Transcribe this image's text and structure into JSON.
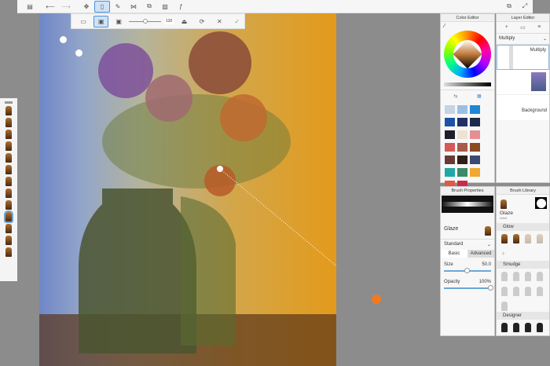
{
  "toolbar": {
    "items": [
      {
        "icon": "gallery-icon"
      },
      {
        "icon": "undo-icon"
      },
      {
        "icon": "redo-icon"
      },
      {
        "icon": "transform-icon"
      },
      {
        "icon": "brush-icon",
        "active": true
      },
      {
        "icon": "pencil-icon"
      },
      {
        "icon": "symmetry-icon"
      },
      {
        "icon": "layers-icon"
      },
      {
        "icon": "image-icon"
      },
      {
        "icon": "curve-icon"
      }
    ]
  },
  "subtoolbar": {
    "size_value": "120"
  },
  "color_editor": {
    "title": "Color Editor",
    "swatches": [
      "#c4d3e6",
      "#9bbfe3",
      "#1f86d6",
      "#1c53a8",
      "#222f66",
      "#1f2a4a",
      "#1e1e2c",
      "#eee2d0",
      "#e49092",
      "#d45b58",
      "#a95a4a",
      "#8a4a22",
      "#6a3a38",
      "#2e1e16",
      "#3a4a70",
      "#20a8a6",
      "#3d8a68",
      "#f0a830",
      "#e05a44",
      "#cc2a4c"
    ]
  },
  "layer_editor": {
    "title": "Layer Editor",
    "blend_mode": "Multiply",
    "layers": [
      {
        "name": "Multiply"
      },
      {
        "name": ""
      },
      {
        "name": "Background"
      }
    ]
  },
  "brush_properties": {
    "title": "Brush Properties",
    "brush_name": "Glaze",
    "mode": "Standard",
    "tabs": [
      "Basic",
      "Advanced"
    ],
    "size_label": "Size",
    "size_value": "50.0",
    "size_fraction": 0.5,
    "opacity_label": "Opacity",
    "opacity_value": "100%",
    "opacity_fraction": 1.0
  },
  "brush_library": {
    "title": "Brush Library",
    "brush_name": "Glaze",
    "brush_sub": "Artist",
    "sections": [
      "Glow",
      "Smudge",
      "Designer"
    ]
  },
  "accent": "#4a90d9"
}
